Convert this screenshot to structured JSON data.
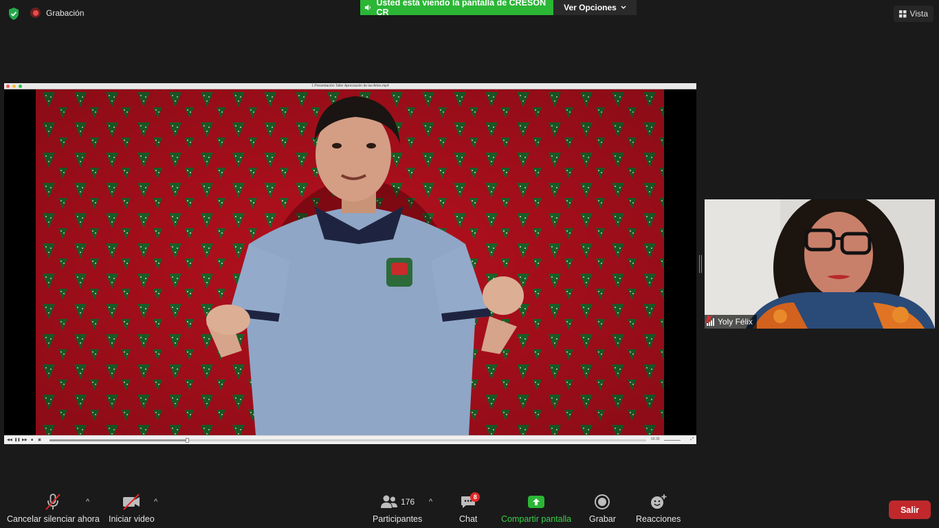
{
  "top_bar": {
    "recording_label": "Grabación",
    "share_banner": "Usted está viendo la pantalla de CRESON CR",
    "view_options_label": "Ver Opciones",
    "view_label": "Vista"
  },
  "player": {
    "title": "1 Presentación Taller Apreciación de las Artes.mp4",
    "progress": 0.23,
    "time": "02:35"
  },
  "participant": {
    "name": "Yoly Félix",
    "muted": true
  },
  "toolbar": {
    "mute_label": "Cancelar silenciar ahora",
    "video_label": "Iniciar video",
    "participants_label": "Participantes",
    "participants_count": "176",
    "chat_label": "Chat",
    "chat_badge": "8",
    "share_label": "Compartir pantalla",
    "record_label": "Grabar",
    "reactions_label": "Reacciones",
    "leave_label": "Salir"
  },
  "colors": {
    "share_green": "#2bb636",
    "leave_red": "#c0282b",
    "background": "#1a1a1a"
  }
}
